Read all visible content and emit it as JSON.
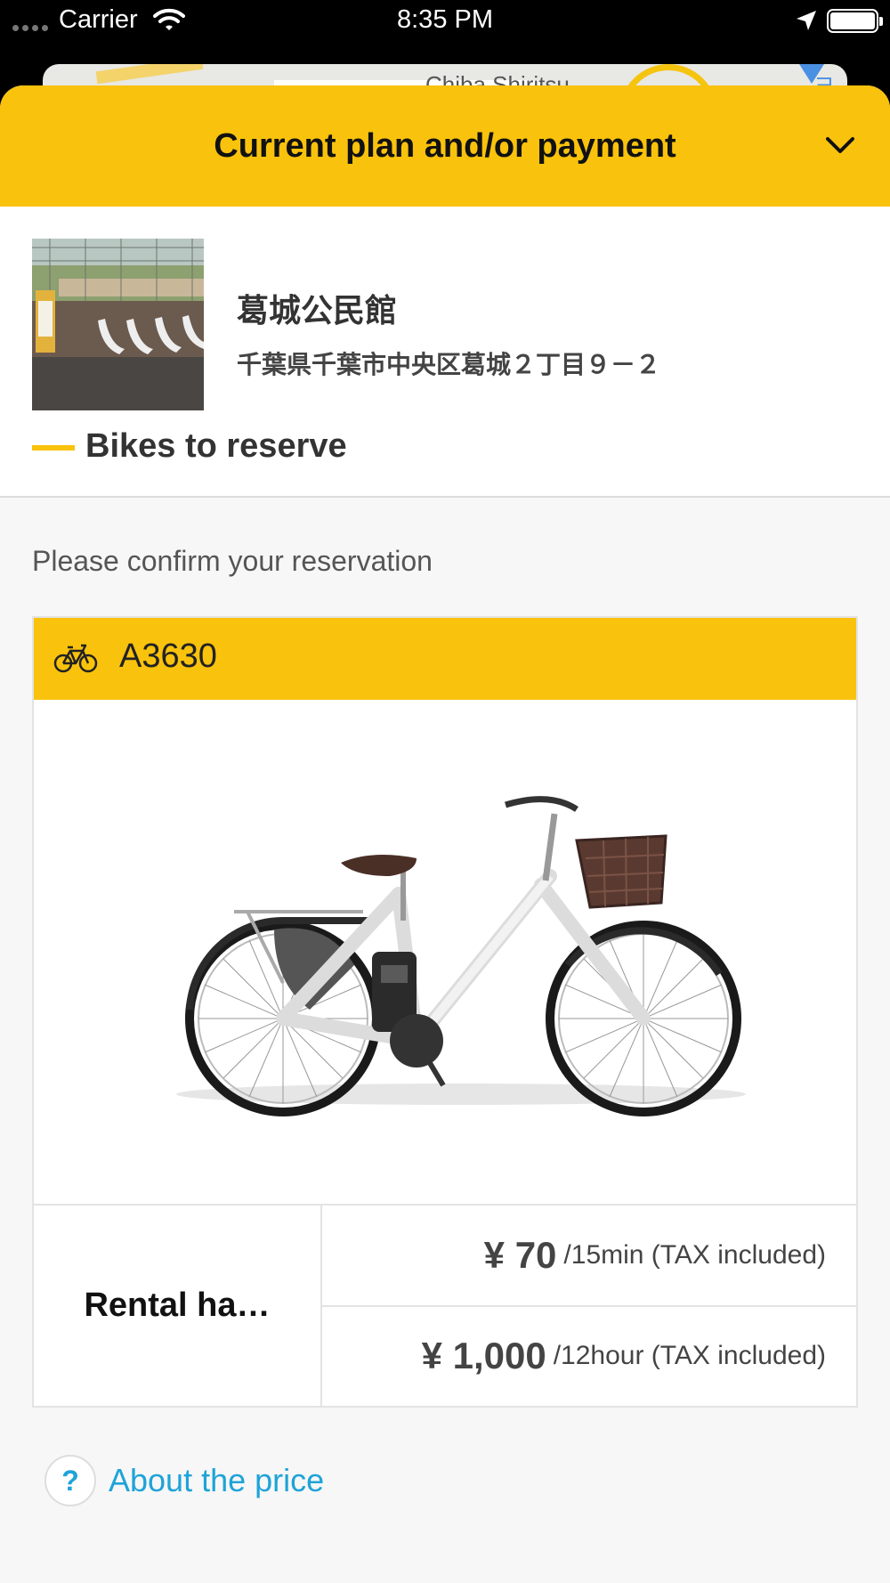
{
  "status_bar": {
    "carrier": "Carrier",
    "time": "8:35 PM",
    "icons": [
      "signal-dots-icon",
      "wifi-icon",
      "location-arrow-icon",
      "battery-icon"
    ]
  },
  "map": {
    "label": "Chiba Shiritsu",
    "label2": "ヨ"
  },
  "sheet": {
    "title": "Current plan and/or payment",
    "collapse_icon": "chevron-down-icon",
    "accent_color": "#f9c20c"
  },
  "station": {
    "name": "葛城公民館",
    "address": "千葉県千葉市中央区葛城２丁目９－２",
    "section_title": "Bikes to reserve"
  },
  "reservation": {
    "confirm_text": "Please confirm your reservation",
    "bike": {
      "id": "A3630",
      "icon": "bicycle-icon"
    },
    "rental_label": "Rental ha…",
    "prices": [
      {
        "amount": "¥ 70",
        "unit": "/15min (TAX included)"
      },
      {
        "amount": "¥ 1,000",
        "unit": "/12hour (TAX included)"
      }
    ]
  },
  "about_price": {
    "icon": "question-icon",
    "icon_glyph": "?",
    "label": "About the price",
    "link_color": "#1fa3d8"
  }
}
